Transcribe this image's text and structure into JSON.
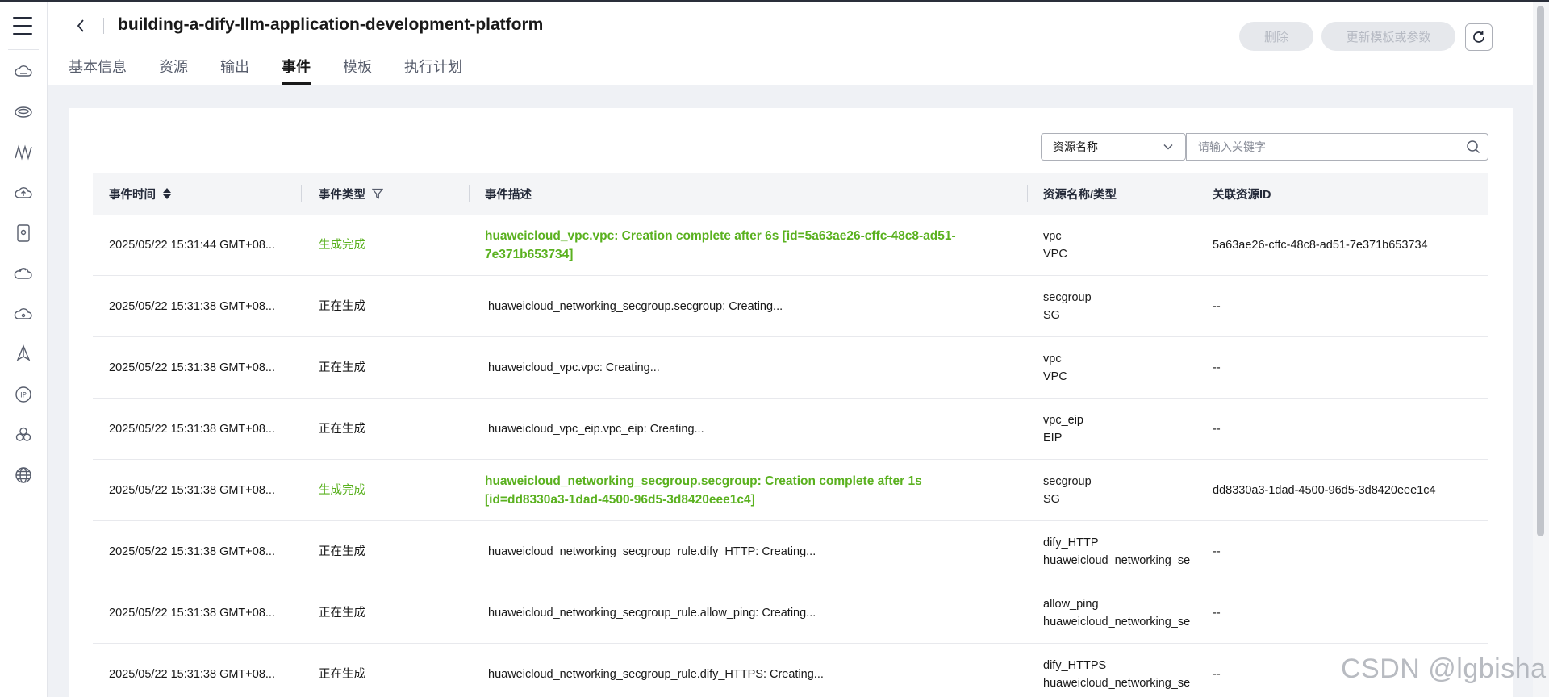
{
  "rail": {
    "menu_icon": "hamburger-menu-icon",
    "icons": [
      "cloud-server-icon",
      "disk-icon",
      "network-waveform-icon",
      "cloud-upload-icon",
      "document-icon",
      "cloud-stack-icon",
      "cloud-link-icon",
      "diamond-icon",
      "ip-address-icon",
      "cluster-icon",
      "globe-icon"
    ]
  },
  "header": {
    "title": "building-a-dify-llm-application-development-platform",
    "delete_label": "删除",
    "update_label": "更新模板或参数"
  },
  "tabs": [
    {
      "label": "基本信息",
      "active": false
    },
    {
      "label": "资源",
      "active": false
    },
    {
      "label": "输出",
      "active": false
    },
    {
      "label": "事件",
      "active": true
    },
    {
      "label": "模板",
      "active": false
    },
    {
      "label": "执行计划",
      "active": false
    }
  ],
  "filter": {
    "selected": "资源名称",
    "search_placeholder": "请输入关键字"
  },
  "table": {
    "columns": {
      "time": "事件时间",
      "type": "事件类型",
      "desc": "事件描述",
      "resource": "资源名称/类型",
      "resource_id": "关联资源ID"
    },
    "rows": [
      {
        "time": "2025/05/22 15:31:44 GMT+08...",
        "type": "生成完成",
        "done": true,
        "desc": "huaweicloud_vpc.vpc: Creation complete after 6s [id=5a63ae26-cffc-48c8-ad51-7e371b653734]",
        "res_name": "vpc",
        "res_type": "VPC",
        "res_id": "5a63ae26-cffc-48c8-ad51-7e371b653734"
      },
      {
        "time": "2025/05/22 15:31:38 GMT+08...",
        "type": "正在生成",
        "done": false,
        "desc": "huaweicloud_networking_secgroup.secgroup: Creating...",
        "res_name": "secgroup",
        "res_type": "SG",
        "res_id": "--"
      },
      {
        "time": "2025/05/22 15:31:38 GMT+08...",
        "type": "正在生成",
        "done": false,
        "desc": "huaweicloud_vpc.vpc: Creating...",
        "res_name": "vpc",
        "res_type": "VPC",
        "res_id": "--"
      },
      {
        "time": "2025/05/22 15:31:38 GMT+08...",
        "type": "正在生成",
        "done": false,
        "desc": "huaweicloud_vpc_eip.vpc_eip: Creating...",
        "res_name": "vpc_eip",
        "res_type": "EIP",
        "res_id": "--"
      },
      {
        "time": "2025/05/22 15:31:38 GMT+08...",
        "type": "生成完成",
        "done": true,
        "desc": "huaweicloud_networking_secgroup.secgroup: Creation complete after 1s [id=dd8330a3-1dad-4500-96d5-3d8420eee1c4]",
        "res_name": "secgroup",
        "res_type": "SG",
        "res_id": "dd8330a3-1dad-4500-96d5-3d8420eee1c4"
      },
      {
        "time": "2025/05/22 15:31:38 GMT+08...",
        "type": "正在生成",
        "done": false,
        "desc": "huaweicloud_networking_secgroup_rule.dify_HTTP: Creating...",
        "res_name": "dify_HTTP",
        "res_type": "huaweicloud_networking_se",
        "res_id": "--"
      },
      {
        "time": "2025/05/22 15:31:38 GMT+08...",
        "type": "正在生成",
        "done": false,
        "desc": "huaweicloud_networking_secgroup_rule.allow_ping: Creating...",
        "res_name": "allow_ping",
        "res_type": "huaweicloud_networking_se",
        "res_id": "--"
      },
      {
        "time": "2025/05/22 15:31:38 GMT+08...",
        "type": "正在生成",
        "done": false,
        "desc": "huaweicloud_networking_secgroup_rule.dify_HTTPS: Creating...",
        "res_name": "dify_HTTPS",
        "res_type": "huaweicloud_networking_se",
        "res_id": "--"
      }
    ]
  },
  "watermark": "CSDN @lgbisha",
  "colors": {
    "success": "#5ab11f",
    "text": "#191919",
    "page_bg": "#eff1f5"
  }
}
